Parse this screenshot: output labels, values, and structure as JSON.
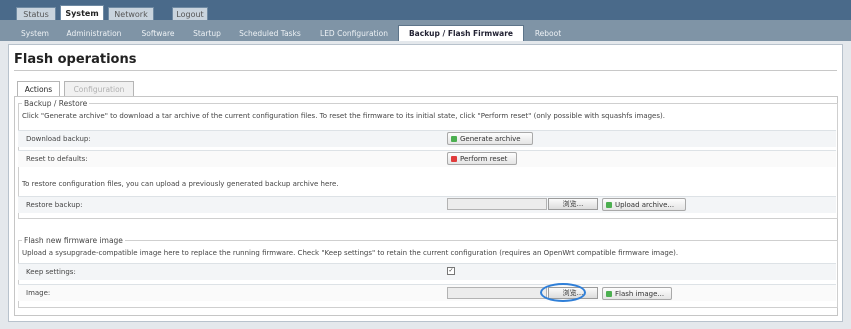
{
  "main_tabs": [
    "Status",
    "System",
    "Network",
    "Logout"
  ],
  "sub_tabs": [
    "System",
    "Administration",
    "Software",
    "Startup",
    "Scheduled Tasks",
    "LED Configuration",
    "Backup / Flash Firmware",
    "Reboot"
  ],
  "page_title": "Flash operations",
  "panel_tabs": [
    "Actions",
    "Configuration"
  ],
  "backup": {
    "legend": "Backup / Restore",
    "description": "Click \"Generate archive\" to download a tar archive of the current configuration files. To reset the firmware to its initial state, click \"Perform reset\" (only possible with squashfs images).",
    "download_label": "Download backup:",
    "generate_button": "Generate archive",
    "reset_label": "Reset to defaults:",
    "reset_button": "Perform reset",
    "restore_description": "To restore configuration files, you can upload a previously generated backup archive here.",
    "restore_label": "Restore backup:",
    "browse_button": "浏览...",
    "upload_button": "Upload archive..."
  },
  "flash": {
    "legend": "Flash new firmware image",
    "description": "Upload a sysupgrade-compatible image here to replace the running firmware. Check \"Keep settings\" to retain the current configuration (requires an OpenWrt compatible firmware image).",
    "keep_label": "Keep settings:",
    "keep_checked": true,
    "image_label": "Image:",
    "browse_button": "浏览...",
    "flash_button": "Flash image..."
  },
  "colors": {
    "topbar": "#4a6a8a",
    "subbar": "#7f94a6",
    "highlight": "#2f7fd8"
  }
}
